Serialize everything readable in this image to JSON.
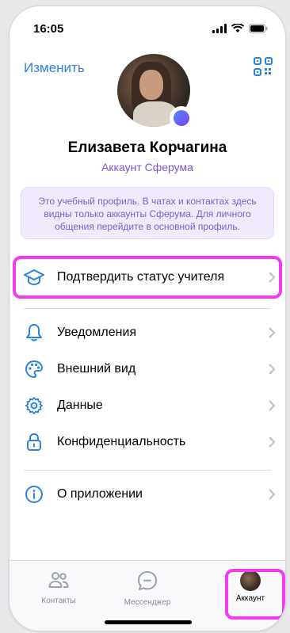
{
  "status_bar": {
    "time": "16:05"
  },
  "header": {
    "edit_label": "Изменить"
  },
  "profile": {
    "name": "Елизавета Корчагина",
    "account_type": "Аккаунт Сферума",
    "info_text": "Это учебный профиль. В чатах и контактах здесь видны только аккаунты Сферума. Для личного общения перейдите в основной профиль."
  },
  "menu": {
    "verify_teacher": "Подтвердить статус учителя",
    "notifications": "Уведомления",
    "appearance": "Внешний вид",
    "data": "Данные",
    "privacy": "Конфиденциальность",
    "about": "О приложении"
  },
  "tabs": [
    {
      "label": "Контакты",
      "icon": "contacts-icon"
    },
    {
      "label": "Мессенджер",
      "icon": "messenger-icon"
    },
    {
      "label": "Аккаунт",
      "icon": "account-avatar"
    }
  ],
  "colors": {
    "accent_blue": "#2d81e0",
    "purple_text": "#7a55d6",
    "highlight_magenta": "#f33cf2",
    "info_bg": "#f1eafd"
  }
}
